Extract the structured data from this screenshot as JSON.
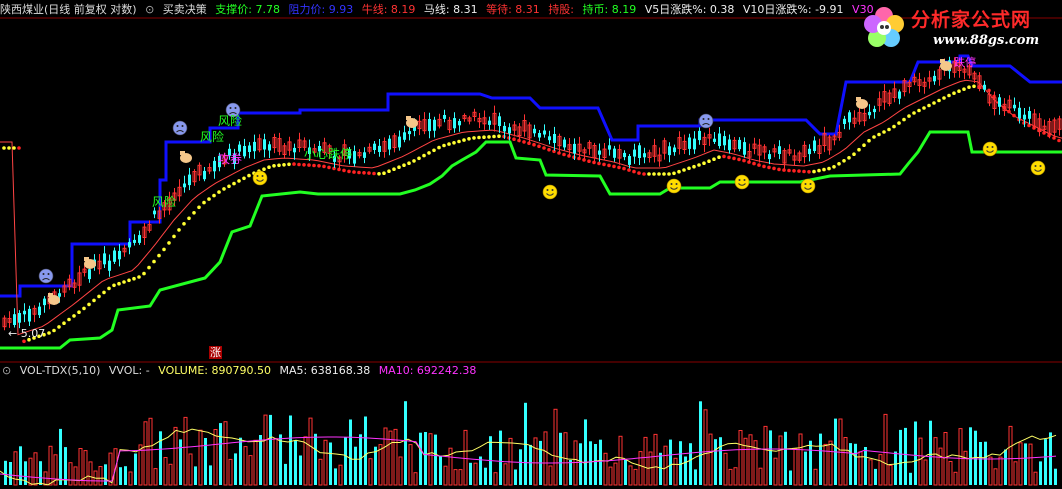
{
  "header": {
    "stock": "陕西煤业(日线 前复权 对数)",
    "indicator_toggle": "⊙",
    "indicator": "买卖决策",
    "support": "支撑价: 7.78",
    "resistance": "阻力价: 9.93",
    "bull": "牛线: 8.19",
    "horse": "马线: 8.31",
    "wait": "等待: 8.31",
    "hold": "持股:",
    "cash": "持币: 8.19",
    "v5": "V5日涨跌%: 0.38",
    "v10": "V10日涨跌%: -9.91",
    "v30": "V30"
  },
  "logo": {
    "name": "分析家公式网",
    "url": "www.88gs.com"
  },
  "labels": {
    "risk1": "风险",
    "risk2": "风险",
    "risk3": "风险",
    "buy1": "攻券",
    "note1": "小心跌停",
    "note2": "跌停",
    "low_marker": "← 5.07",
    "limit_up": "涨"
  },
  "volume_header": {
    "toggle": "⊙",
    "name": "VOL-TDX(5,10)",
    "vvol": "VVOL: -",
    "volume": "VOLUME: 890790.50",
    "ma5": "MA5: 638168.38",
    "ma10": "MA10: 692242.38"
  },
  "colors": {
    "up": "#ff3333",
    "down": "#33ffff",
    "resistance": "#1010ff",
    "support": "#22ff22",
    "support_label": "#22ff22",
    "resistance_label": "#3333ff",
    "bull": "#ff3333",
    "wait": "#ff3333",
    "cash": "#22ff22",
    "ma5": "#ffff66",
    "ma10": "#ff33ff",
    "grid": "#880000",
    "dots_yellow": "#ffff33",
    "dots_red": "#ff2222"
  },
  "chart_data": {
    "type": "candlestick",
    "scale": "log",
    "low_price": 5.07,
    "support": 7.78,
    "resistance": 9.93,
    "bull_line": 8.19,
    "horse_line": 8.31,
    "volume_last": 890790.5,
    "ma5_last": 638168.38,
    "ma10_last": 692242.38
  }
}
